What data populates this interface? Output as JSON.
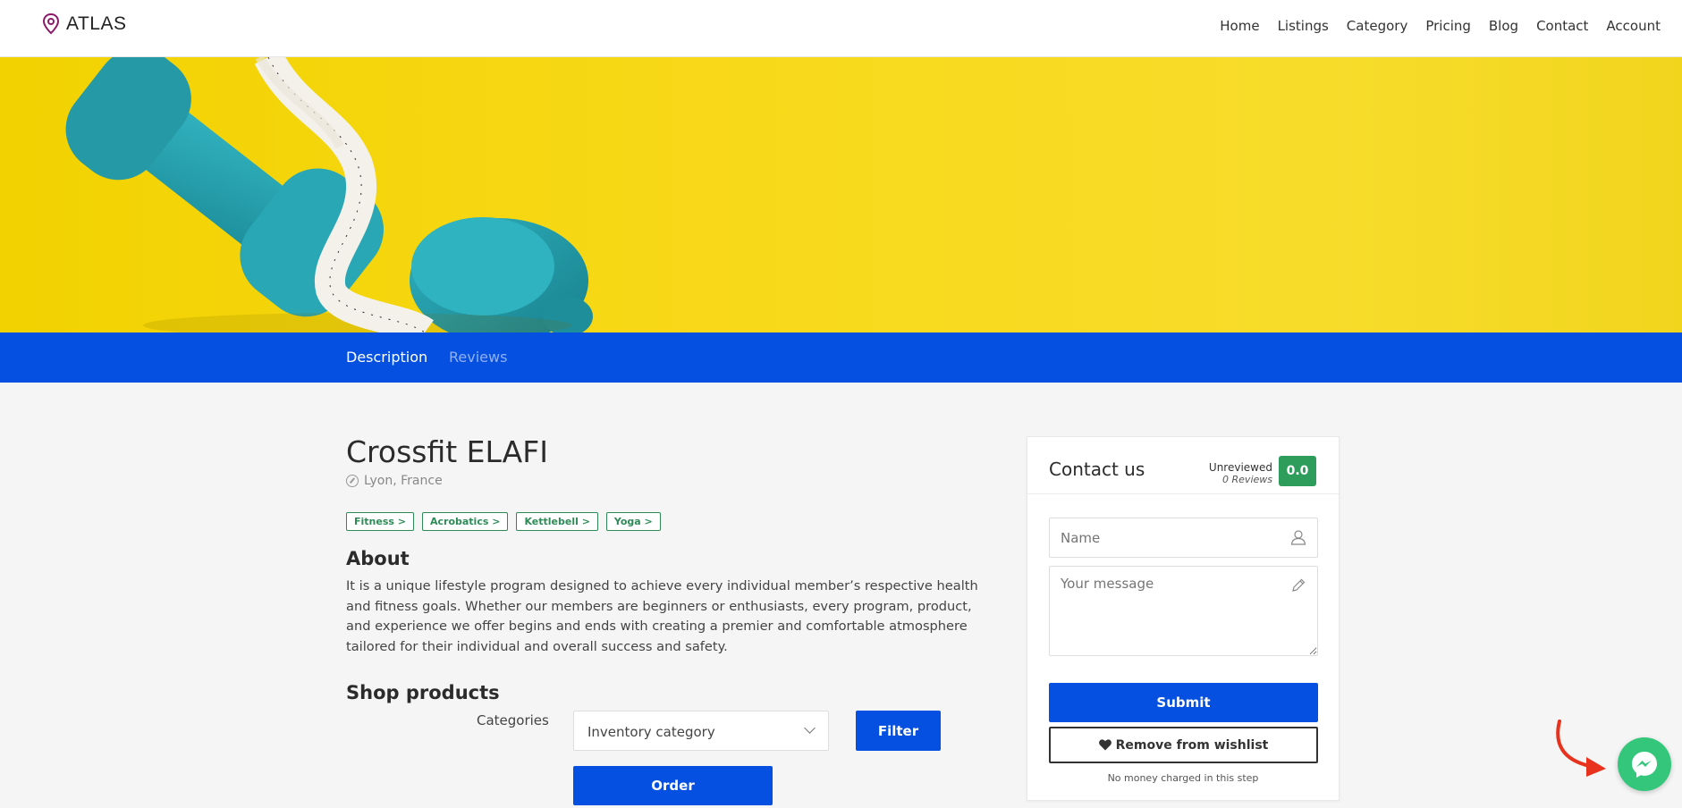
{
  "brand": {
    "name": "ATLAS"
  },
  "nav": [
    "Home",
    "Listings",
    "Category",
    "Pricing",
    "Blog",
    "Contact",
    "Account"
  ],
  "tabs": {
    "description": "Description",
    "reviews": "Reviews"
  },
  "listing": {
    "title": "Crossfit ELAFI",
    "location": "Lyon, France",
    "tags": [
      "Fitness >",
      "Acrobatics >",
      "Kettlebell >",
      "Yoga >"
    ],
    "about_heading": "About",
    "about_text": "It is a unique lifestyle program designed to achieve every individual member’s respective health and fitness goals. Whether our members are beginners or enthusiasts, every program, product, and experience we offer begins and ends with creating a premier and comfortable atmosphere tailored for their individual and overall success and safety."
  },
  "shop": {
    "heading": "Shop products",
    "categories_label": "Categories",
    "category_selected": "Inventory category",
    "filter_label": "Filter",
    "order_label": "Order"
  },
  "contact": {
    "title": "Contact us",
    "review_status": "Unreviewed",
    "review_count": "0 Reviews",
    "score": "0.0",
    "name_placeholder": "Name",
    "message_placeholder": "Your message",
    "submit_label": "Submit",
    "wishlist_label": "Remove from wishlist",
    "note": "No money charged in this step"
  },
  "colors": {
    "primary": "#0550e0",
    "tag_green": "#2e8b57",
    "score_green": "#2e9d5c",
    "hero_yellow": "#f7d91a",
    "dumbbell_teal": "#27a6b4",
    "messenger_green": "#34c77b",
    "arrow_red": "#e8321e"
  },
  "icons": {
    "logo": "map-pin-icon",
    "location": "compass-icon",
    "name_field": "user-icon",
    "message_field": "pencil-icon",
    "wishlist": "heart-icon",
    "chat": "messenger-icon"
  }
}
